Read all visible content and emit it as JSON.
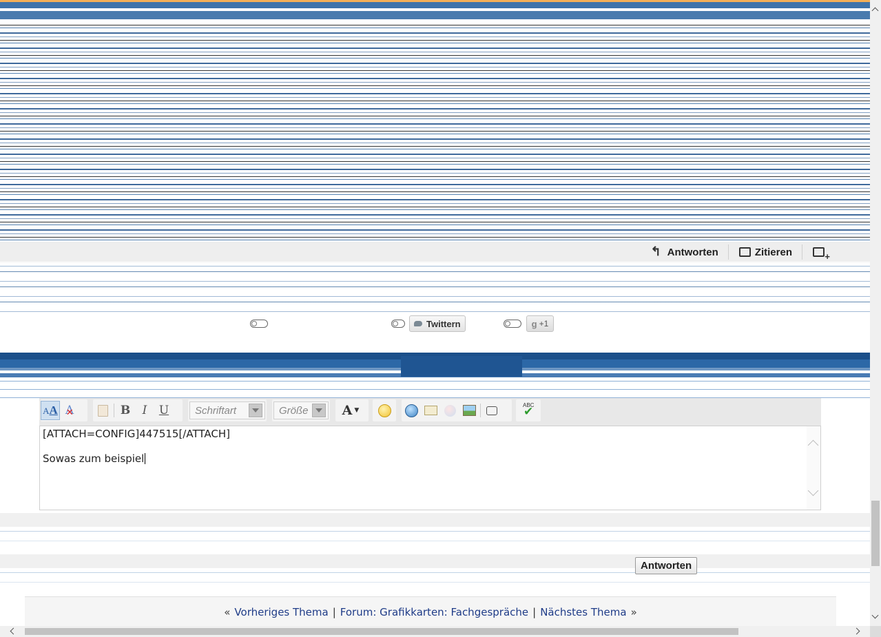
{
  "post_actions": {
    "reply_label": "Antworten",
    "quote_label": "Zitieren"
  },
  "social": {
    "twitter_label": "Twittern",
    "gplus_label": "+1",
    "gplus_g": "g"
  },
  "editor": {
    "font_placeholder": "Schriftart",
    "size_placeholder": "Größe",
    "lines": [
      "[ATTACH=CONFIG]447515[/ATTACH]",
      "",
      "Sowas zum beispiel"
    ],
    "submit_label": "Antworten"
  },
  "thread_nav": {
    "prev_marker": "«",
    "prev_label": "Vorheriges Thema",
    "separator": "|",
    "forum_label": "Forum: Grafikkarten: Fachgespräche",
    "next_label": "Nächstes Thema",
    "next_marker": "»"
  },
  "colors": {
    "link": "#1f3c88",
    "brand_blue": "#1f5592",
    "accent_orange": "#f3a23a"
  }
}
